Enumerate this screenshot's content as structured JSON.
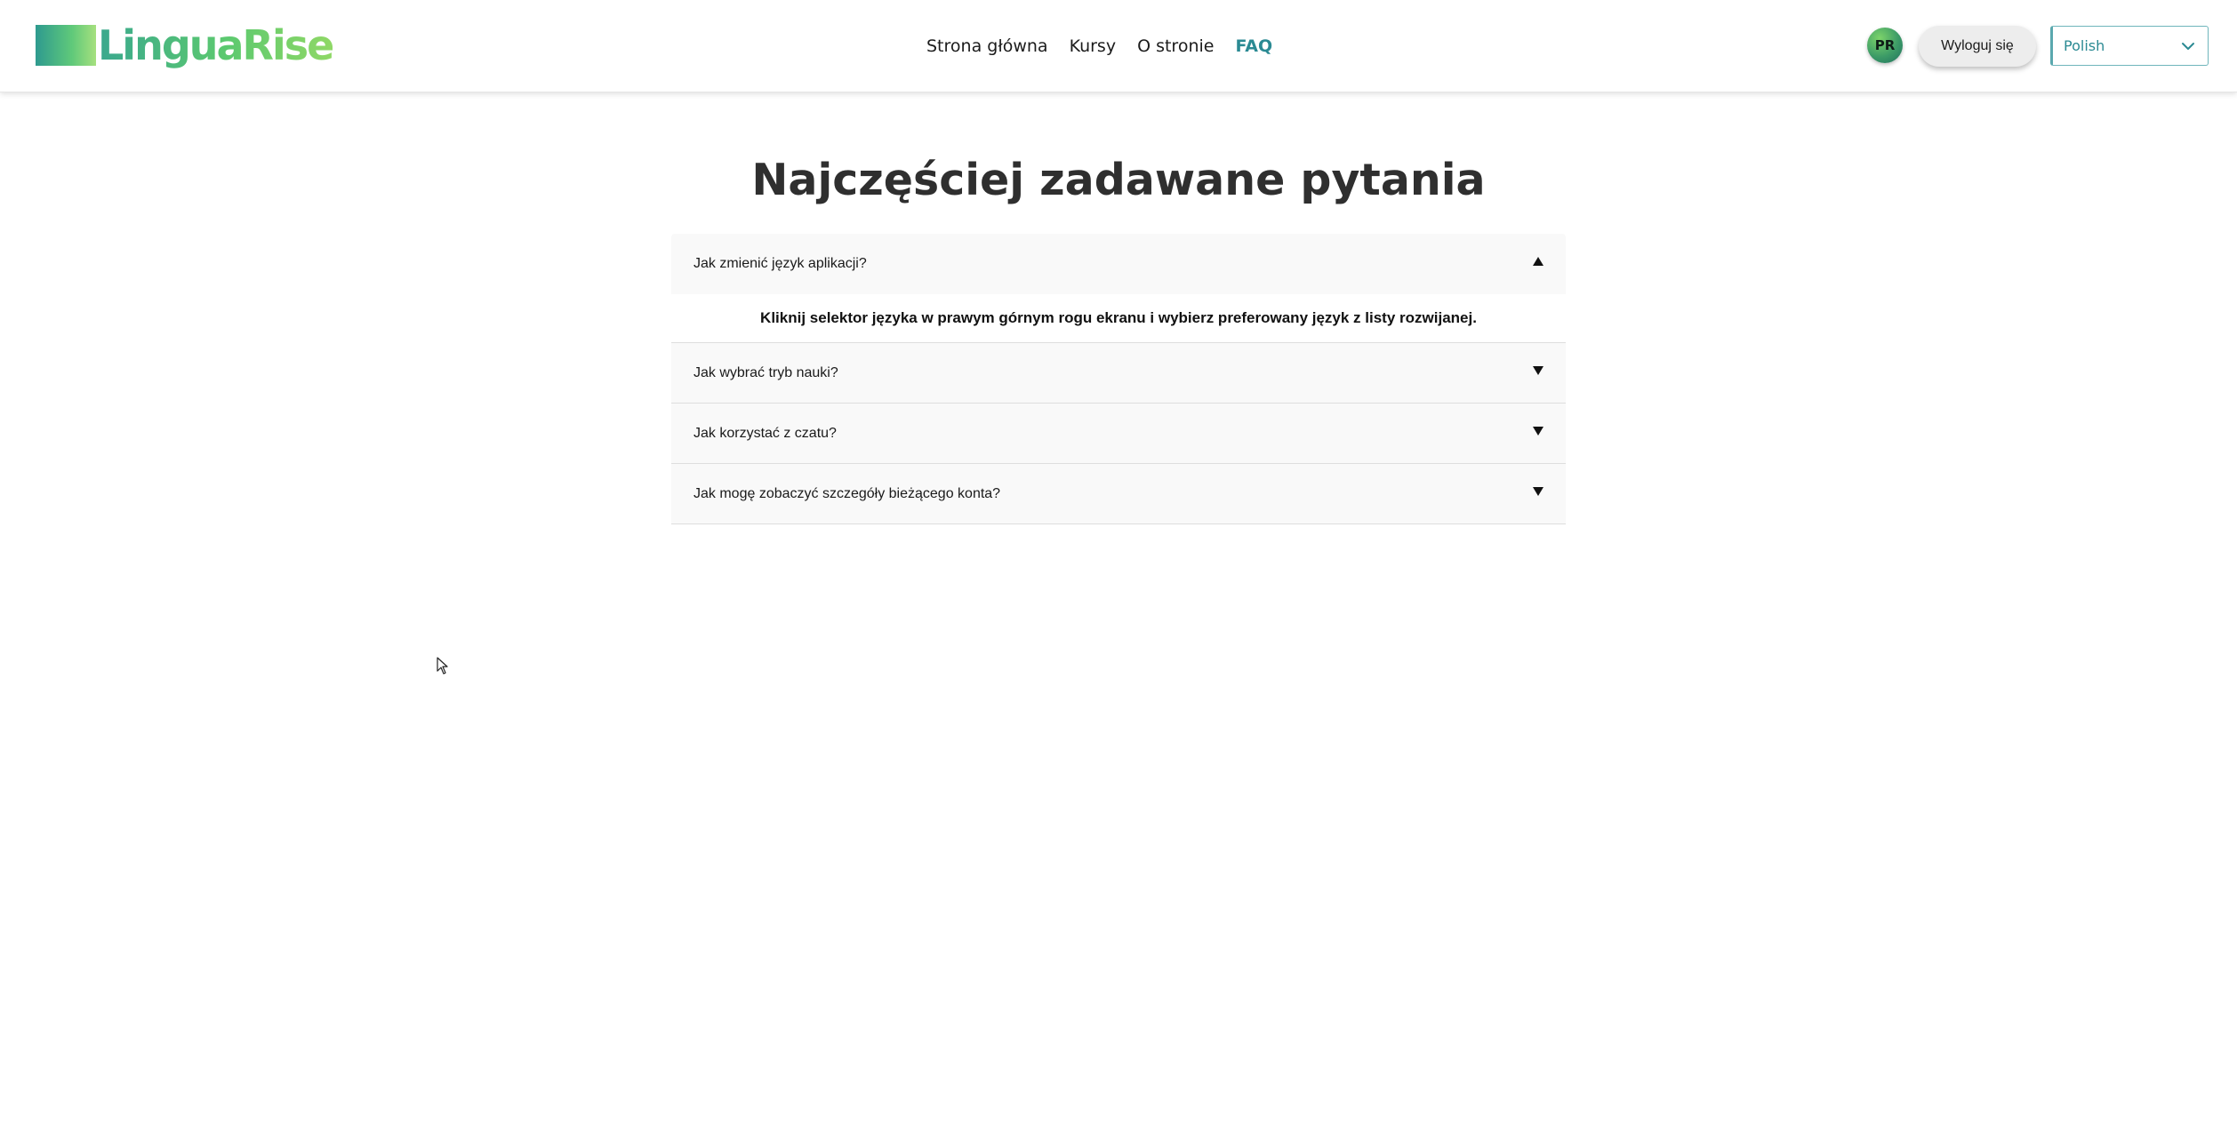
{
  "header": {
    "logo_text": "LinguaRise",
    "nav": [
      {
        "label": "Strona główna"
      },
      {
        "label": "Kursy"
      },
      {
        "label": "O stronie"
      },
      {
        "label": "FAQ"
      }
    ],
    "avatar_initials": "PR",
    "logout_label": "Wyloguj się",
    "language_selected": "Polish"
  },
  "main": {
    "title": "Najczęściej zadawane pytania",
    "faq": [
      {
        "question": "Jak zmienić język aplikacji?",
        "expanded": true,
        "answer": "Kliknij selektor języka w prawym górnym rogu ekranu i wybierz preferowany język z listy rozwijanej."
      },
      {
        "question": "Jak wybrać tryb nauki?",
        "expanded": false
      },
      {
        "question": "Jak korzystać z czatu?",
        "expanded": false
      },
      {
        "question": "Jak mogę zobaczyć szczegóły bieżącego konta?",
        "expanded": false
      }
    ]
  },
  "colors": {
    "accent": "#2b8a93",
    "logo_gradient_start": "#2e9a8f",
    "logo_gradient_end": "#8fd866",
    "faq_bg": "#f9f9f9"
  },
  "icons": {
    "expand_open": "triangle-up-icon",
    "expand_closed": "triangle-down-icon",
    "select_chevron": "chevron-down-icon",
    "pointer": "mouse-cursor-icon"
  }
}
